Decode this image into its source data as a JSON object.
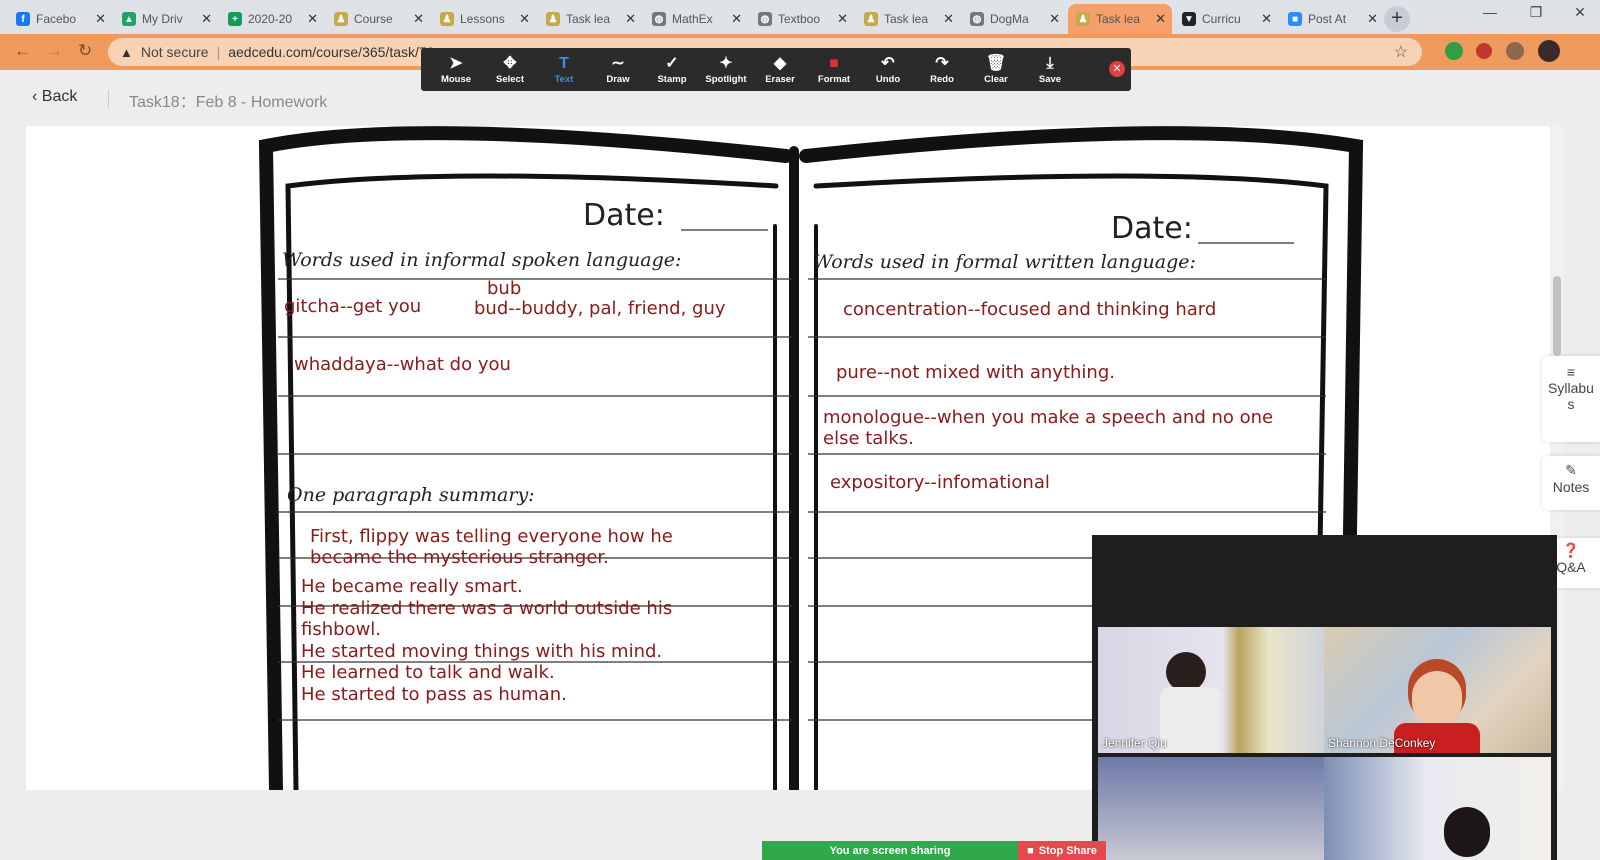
{
  "tabs": [
    {
      "label": "Facebo",
      "color": "#1877f2",
      "glyph": "f"
    },
    {
      "label": "My Driv",
      "color": "#1fa463",
      "glyph": "▲"
    },
    {
      "label": "2020-20",
      "color": "#0f9d58",
      "glyph": "+"
    },
    {
      "label": "Course",
      "color": "#c8a84b",
      "glyph": "♟"
    },
    {
      "label": "Lessons",
      "color": "#c8a84b",
      "glyph": "♟"
    },
    {
      "label": "Task lea",
      "color": "#c8a84b",
      "glyph": "♟"
    },
    {
      "label": "MathEx",
      "color": "#777777",
      "glyph": "◍"
    },
    {
      "label": "Textboo",
      "color": "#777777",
      "glyph": "◍"
    },
    {
      "label": "Task lea",
      "color": "#c8a84b",
      "glyph": "♟"
    },
    {
      "label": "DogMa",
      "color": "#777777",
      "glyph": "◍"
    },
    {
      "label": "Task lea",
      "color": "#c8a84b",
      "glyph": "♟"
    },
    {
      "label": "Curricu",
      "color": "#222222",
      "glyph": "▼"
    },
    {
      "label": "Post At",
      "color": "#2d8cff",
      "glyph": "■"
    }
  ],
  "address": {
    "warning": "Not secure",
    "url": "aedcedu.com/course/365/task/7?..."
  },
  "annotate_tools": [
    {
      "icon": "➤",
      "label": "Mouse"
    },
    {
      "icon": "✥",
      "label": "Select"
    },
    {
      "icon": "T",
      "label": "Text"
    },
    {
      "icon": "∼",
      "label": "Draw"
    },
    {
      "icon": "✓",
      "label": "Stamp"
    },
    {
      "icon": "✦",
      "label": "Spotlight"
    },
    {
      "icon": "◆",
      "label": "Eraser"
    },
    {
      "icon": "■",
      "label": "Format"
    },
    {
      "icon": "↶",
      "label": "Undo"
    },
    {
      "icon": "↷",
      "label": "Redo"
    },
    {
      "icon": "🗑",
      "label": "Clear"
    },
    {
      "icon": "⤓",
      "label": "Save"
    }
  ],
  "header": {
    "back": "Back",
    "task": "Task18：Feb 8 - Homework"
  },
  "worksheet": {
    "date_left": "Date:",
    "date_right": "Date:",
    "informal_label": "Words used in informal spoken language:",
    "formal_label": "Words used in formal written language:",
    "summary_label": "One paragraph summary:",
    "informal": [
      "gitcha--get you",
      "bub",
      "bud--buddy, pal, friend, guy",
      "whaddaya--what do you"
    ],
    "formal": [
      "concentration--focused and thinking hard",
      "pure--not mixed with anything.",
      "monologue--when you make  a speech and no one",
      "else talks.",
      "expository--infomational"
    ],
    "summary": [
      "First, flippy was telling everyone how he",
      "became the mysterious stranger.",
      "He became really smart.",
      "He realized there was a world outside his",
      "fishbowl.",
      "He started moving things with his mind.",
      "He learned to talk and walk.",
      "He started to pass as human."
    ]
  },
  "side": {
    "syllabus1": "Syllabu",
    "syllabus2": "s",
    "notes": "Notes",
    "qa": "Q&A"
  },
  "video": {
    "p1": "Jennifer Qiu",
    "p2": "Shannon DeConkey"
  },
  "share": {
    "status": "You are screen sharing",
    "stop": "Stop Share"
  }
}
